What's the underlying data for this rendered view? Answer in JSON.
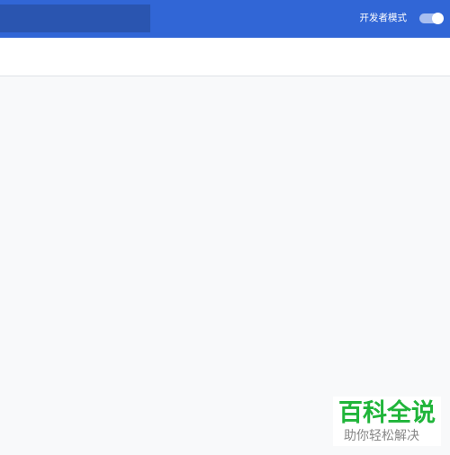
{
  "header": {
    "search_value": "",
    "dev_mode_label": "开发者模式",
    "dev_mode_enabled": true
  },
  "watermark": {
    "title": "百科全说",
    "subtitle": "助你轻松解决"
  },
  "colors": {
    "header_bg": "#3166d6",
    "search_bg": "#2a55b0",
    "page_bg": "#f8f9fa",
    "watermark_green": "#20b53a"
  }
}
